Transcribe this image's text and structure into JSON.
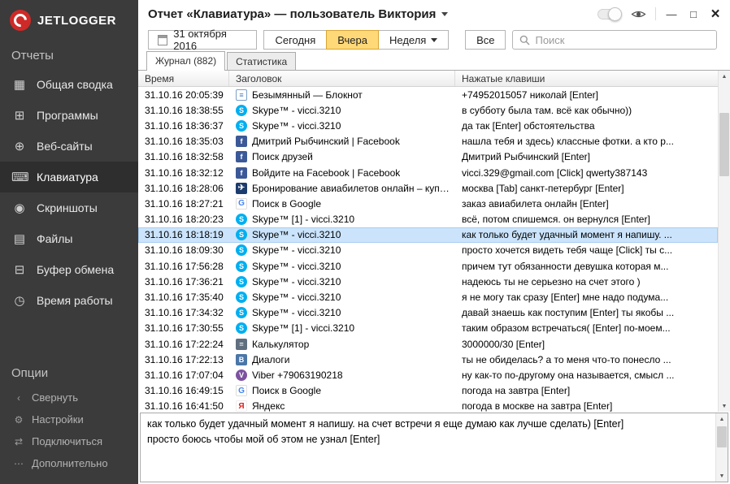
{
  "brand": {
    "name": "JETLOGGER"
  },
  "titlebar": {
    "title": "Отчет «Клавиатура» — пользователь Виктория"
  },
  "toolbar": {
    "date": "31 октября 2016",
    "today": "Сегодня",
    "yesterday": "Вчера",
    "week": "Неделя",
    "all": "Все",
    "search_placeholder": "Поиск"
  },
  "tabs": {
    "journal": "Журнал (882)",
    "stats": "Статистика"
  },
  "sidebar": {
    "reports_header": "Отчеты",
    "options_header": "Опции",
    "reports": [
      {
        "id": "summary",
        "label": "Общая сводка",
        "icon": "dashboard-icon",
        "glyph": "▦"
      },
      {
        "id": "programs",
        "label": "Программы",
        "icon": "programs-icon",
        "glyph": "⊞"
      },
      {
        "id": "websites",
        "label": "Веб-сайты",
        "icon": "globe-icon",
        "glyph": "⊕"
      },
      {
        "id": "keyboard",
        "label": "Клавиатура",
        "icon": "keyboard-icon",
        "glyph": "⌨",
        "active": true
      },
      {
        "id": "screenshots",
        "label": "Скриншоты",
        "icon": "camera-icon",
        "glyph": "◉"
      },
      {
        "id": "files",
        "label": "Файлы",
        "icon": "files-icon",
        "glyph": "▤"
      },
      {
        "id": "clipboard",
        "label": "Буфер обмена",
        "icon": "clipboard-icon",
        "glyph": "⊟"
      },
      {
        "id": "worktime",
        "label": "Время работы",
        "icon": "clock-icon",
        "glyph": "◷"
      }
    ],
    "options": [
      {
        "id": "collapse",
        "label": "Свернуть",
        "icon": "chevron-left-icon",
        "glyph": "‹"
      },
      {
        "id": "settings",
        "label": "Настройки",
        "icon": "gear-icon",
        "glyph": "⚙"
      },
      {
        "id": "connect",
        "label": "Подключиться",
        "icon": "connect-icon",
        "glyph": "⇄"
      },
      {
        "id": "more",
        "label": "Дополнительно",
        "icon": "more-icon",
        "glyph": "⋯"
      }
    ]
  },
  "table": {
    "columns": [
      "Время",
      "Заголовок",
      "Нажатые клавиши"
    ],
    "icon_glyphs": {
      "notepad": "≡",
      "skype": "S",
      "facebook": "f",
      "plane": "✈",
      "google": "G",
      "calculator": "=",
      "dialogs": "В",
      "viber": "V",
      "yandex": "Я"
    },
    "rows": [
      {
        "time": "31.10.16 20:05:39",
        "icon": "notepad",
        "title": "Безымянный — Блокнот",
        "keys": "+74952015057 николай [Enter]"
      },
      {
        "time": "31.10.16 18:38:55",
        "icon": "skype",
        "title": "Skype™ - vicci.3210",
        "keys": "в субботу была там. всё как обычно))"
      },
      {
        "time": "31.10.16 18:36:37",
        "icon": "skype",
        "title": "Skype™ - vicci.3210",
        "keys": "да так [Enter] обстоятельства"
      },
      {
        "time": "31.10.16 18:35:03",
        "icon": "facebook",
        "title": "Дмитрий Рыбчинский | Facebook",
        "keys": "нашла тебя и здесь) классные фотки. а кто р..."
      },
      {
        "time": "31.10.16 18:32:58",
        "icon": "facebook",
        "title": "Поиск друзей",
        "keys": "Дмитрий Рыбчинский [Enter]"
      },
      {
        "time": "31.10.16 18:32:12",
        "icon": "facebook",
        "title": "Войдите на Facebook | Facebook",
        "keys": "vicci.329@gmail.com [Click] qwerty387143"
      },
      {
        "time": "31.10.16 18:28:06",
        "icon": "plane",
        "title": "Бронирование авиабилетов онлайн – купит...",
        "keys": "москва [Tab] санкт-петербург [Enter]"
      },
      {
        "time": "31.10.16 18:27:21",
        "icon": "google",
        "title": "Поиск в Google",
        "keys": "заказ авиабилета онлайн [Enter]"
      },
      {
        "time": "31.10.16 18:20:23",
        "icon": "skype",
        "title": "Skype™ [1] - vicci.3210",
        "keys": "всё, потом спишемся. он вернулся [Enter]"
      },
      {
        "time": "31.10.16 18:18:19",
        "icon": "skype",
        "title": "Skype™ - vicci.3210",
        "keys": "как только будет удачный момент я напишу. ...",
        "selected": true
      },
      {
        "time": "31.10.16 18:09:30",
        "icon": "skype",
        "title": "Skype™ - vicci.3210",
        "keys": "просто хочется видеть тебя чаще [Click] ты с..."
      },
      {
        "time": "31.10.16 17:56:28",
        "icon": "skype",
        "title": "Skype™ - vicci.3210",
        "keys": "причем тут обязанности девушка которая м..."
      },
      {
        "time": "31.10.16 17:36:21",
        "icon": "skype",
        "title": "Skype™ - vicci.3210",
        "keys": "надеюсь ты не серьезно на счет этого )"
      },
      {
        "time": "31.10.16 17:35:40",
        "icon": "skype",
        "title": "Skype™ - vicci.3210",
        "keys": "я не могу так сразу [Enter] мне надо подума..."
      },
      {
        "time": "31.10.16 17:34:32",
        "icon": "skype",
        "title": "Skype™ - vicci.3210",
        "keys": "давай знаешь как поступим [Enter] ты якобы ..."
      },
      {
        "time": "31.10.16 17:30:55",
        "icon": "skype",
        "title": "Skype™ [1] - vicci.3210",
        "keys": "таким образом встречаться( [Enter] по-моем..."
      },
      {
        "time": "31.10.16 17:22:24",
        "icon": "calculator",
        "title": "Калькулятор",
        "keys": "3000000/30 [Enter]"
      },
      {
        "time": "31.10.16 17:22:13",
        "icon": "dialogs",
        "title": "Диалоги",
        "keys": "ты не обиделась? а то меня что-то понесло ..."
      },
      {
        "time": "31.10.16 17:07:04",
        "icon": "viber",
        "title": "Viber +79063190218",
        "keys": "ну как-то по-другому она называется, смысл ..."
      },
      {
        "time": "31.10.16 16:49:15",
        "icon": "google",
        "title": "Поиск в Google",
        "keys": "погода на завтра [Enter]"
      },
      {
        "time": "31.10.16 16:41:50",
        "icon": "yandex",
        "title": "Яндекс",
        "keys": "погода в москве на завтра [Enter]"
      }
    ]
  },
  "detail": {
    "lines": [
      "как только будет удачный момент я напишу. на счет встречи я еще думаю как лучше сделать) [Enter]",
      "просто боюсь чтобы мой об этом не узнал [Enter]"
    ]
  }
}
